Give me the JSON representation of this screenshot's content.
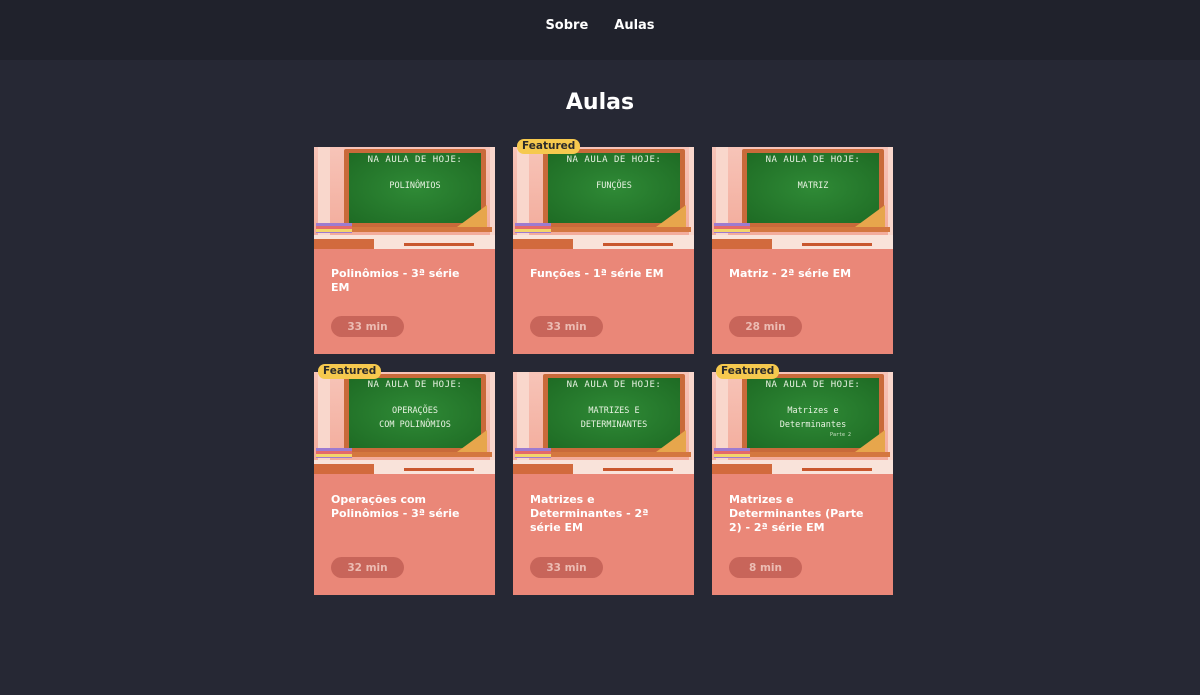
{
  "nav": {
    "items": [
      "Sobre",
      "Aulas"
    ]
  },
  "page": {
    "title": "Aulas"
  },
  "board": {
    "heading": "NA AULA DE HOJE:"
  },
  "badge_label": "Featured",
  "cards": [
    {
      "topic": "POLINÔMIOS",
      "title": "Polinômios - 3ª série EM",
      "duration": "33 min",
      "featured": false
    },
    {
      "topic": "FUNÇÕES",
      "title": "Funções - 1ª série EM",
      "duration": "33 min",
      "featured": true
    },
    {
      "topic": "MATRIZ",
      "title": "Matriz - 2ª série EM",
      "duration": "28 min",
      "featured": false
    },
    {
      "topic": "OPERAÇÕES\nCOM POLINÔMIOS",
      "title": "Operações com Polinômios - 3ª série",
      "duration": "32 min",
      "featured": true
    },
    {
      "topic": "MATRIZES E\nDETERMINANTES",
      "title": "Matrizes e Determinantes - 2ª série EM",
      "duration": "33 min",
      "featured": false
    },
    {
      "topic": "Matrizes e\nDeterminantes",
      "topic_note": "Parte 2",
      "title": "Matrizes e Determinantes (Parte 2) - 2ª série EM",
      "duration": "8 min",
      "featured": true
    }
  ]
}
